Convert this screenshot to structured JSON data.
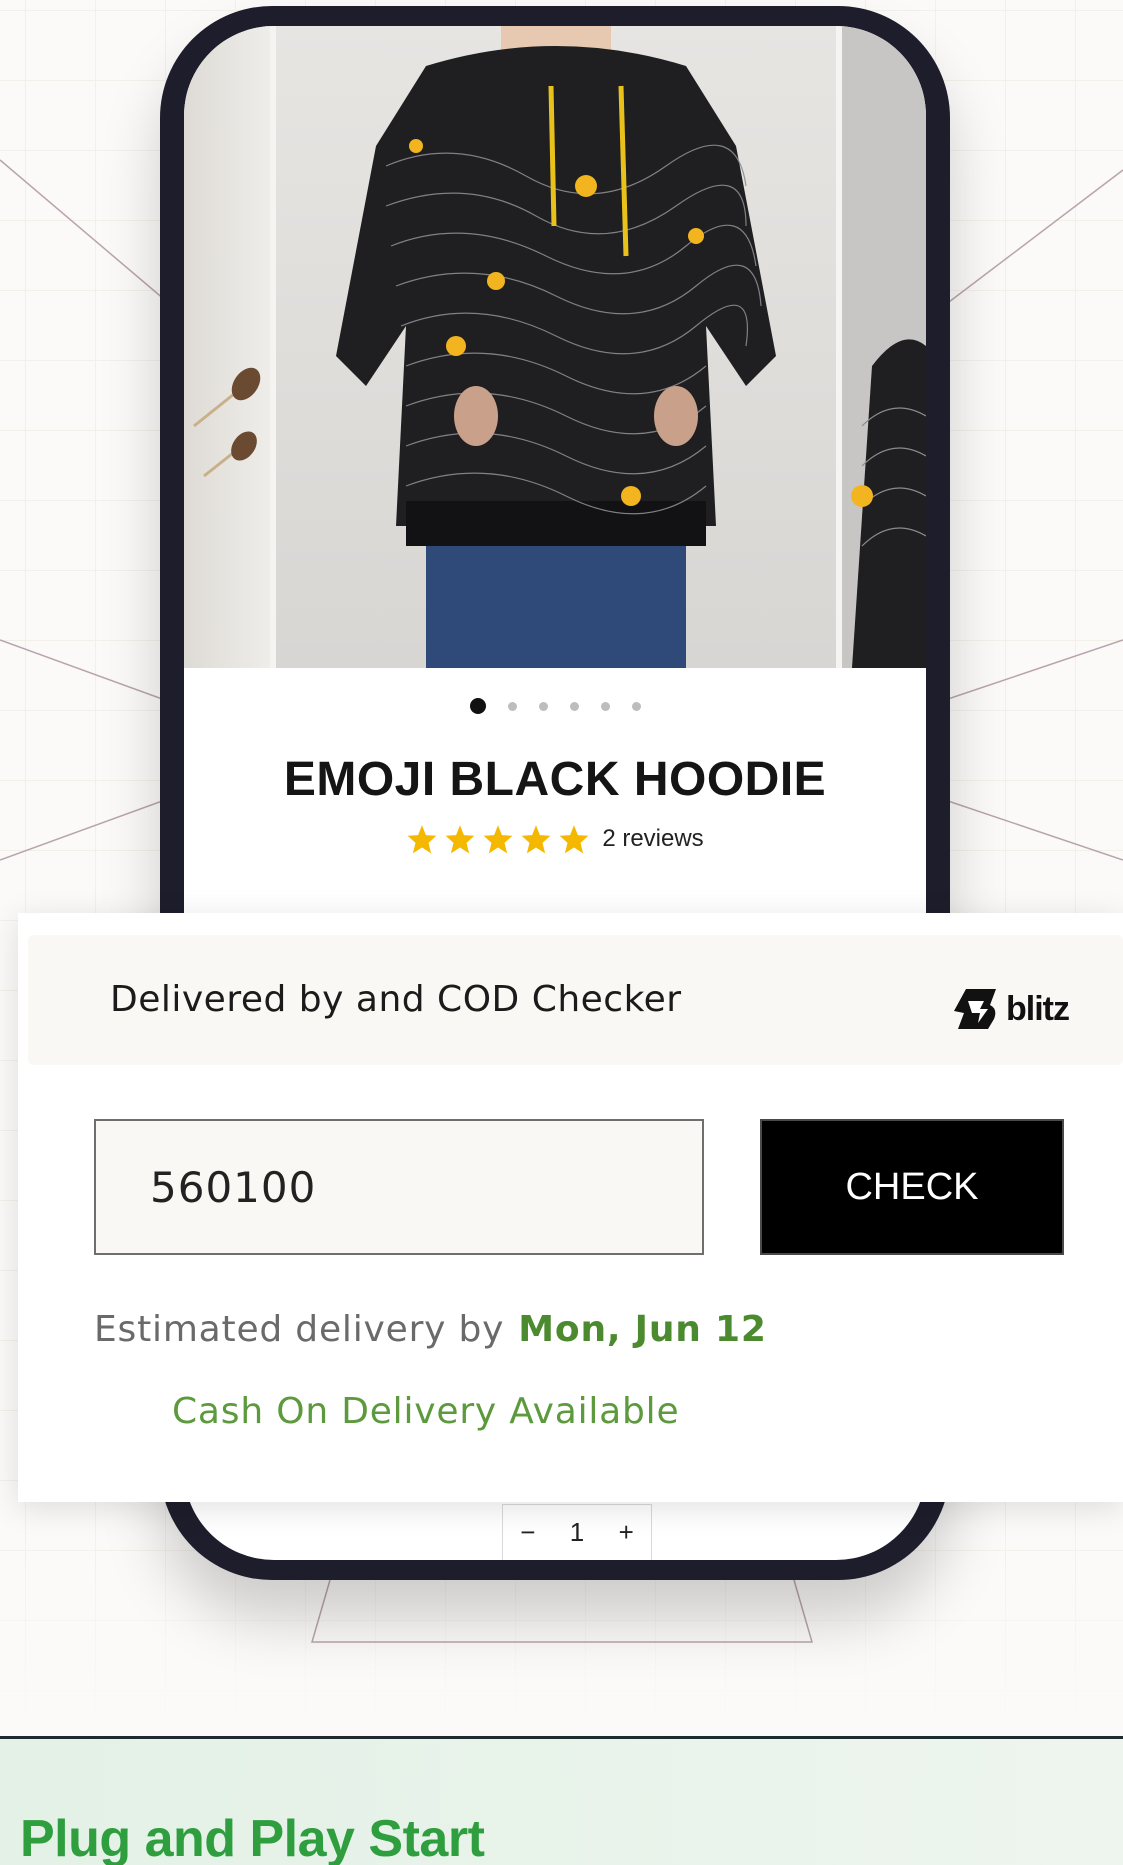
{
  "product": {
    "title": "EMOJI BLACK HOODIE",
    "rating_stars": 5,
    "reviews_text": "2 reviews",
    "gallery_count": 6,
    "active_image": 1,
    "quantity": "1",
    "qty_minus": "−",
    "qty_plus": "+"
  },
  "checker": {
    "heading": "Delivered by and COD Checker",
    "brand": "blitz",
    "pincode_value": "560100",
    "check_label": "CHECK",
    "estimate_label": "Estimated delivery by",
    "estimate_date": "Mon, Jun 12",
    "cod_status": "Cash On Delivery Available"
  },
  "banner": {
    "title": "Plug and Play Start"
  },
  "colors": {
    "accent_green": "#4b8a2e",
    "banner_green": "#2f9e3e",
    "star": "#f5b800",
    "phone_frame": "#1d1d2c"
  },
  "icons": [
    "zoom-icon",
    "star-icon",
    "blitz-logo-icon"
  ]
}
